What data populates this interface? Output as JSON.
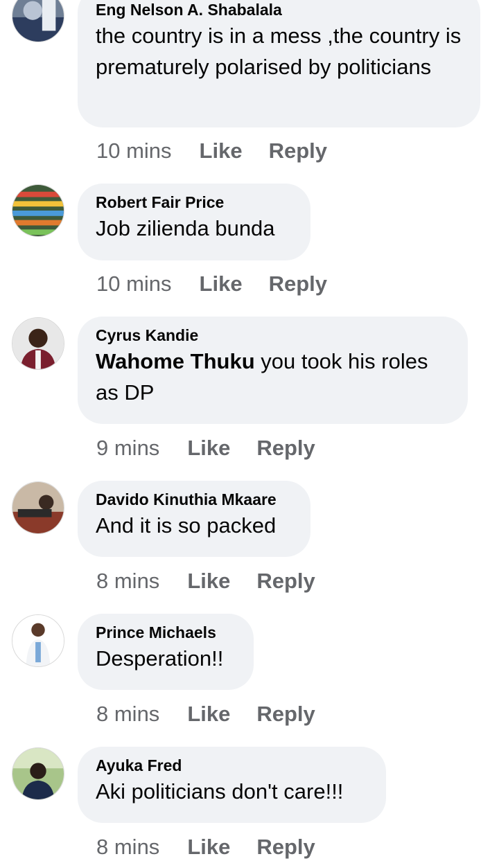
{
  "comments": [
    {
      "author": "Eng Nelson A. Shabalala",
      "text": "the country is in a mess ,the country is prematurely polarised by politicians",
      "time": "10 mins"
    },
    {
      "author": "Robert Fair Price",
      "text": "Job zilienda bunda",
      "time": "10 mins"
    },
    {
      "author": "Cyrus Kandie",
      "mention": "Wahome Thuku",
      "text": " you took his roles as DP",
      "time": "9 mins"
    },
    {
      "author": "Davido Kinuthia Mkaare",
      "text": "And it is so packed",
      "time": "8 mins"
    },
    {
      "author": "Prince Michaels",
      "text": "Desperation!!",
      "time": "8 mins"
    },
    {
      "author": "Ayuka Fred",
      "text": "Aki politicians don't care!!!",
      "time": "8 mins"
    }
  ],
  "actions": {
    "like": "Like",
    "reply": "Reply"
  }
}
